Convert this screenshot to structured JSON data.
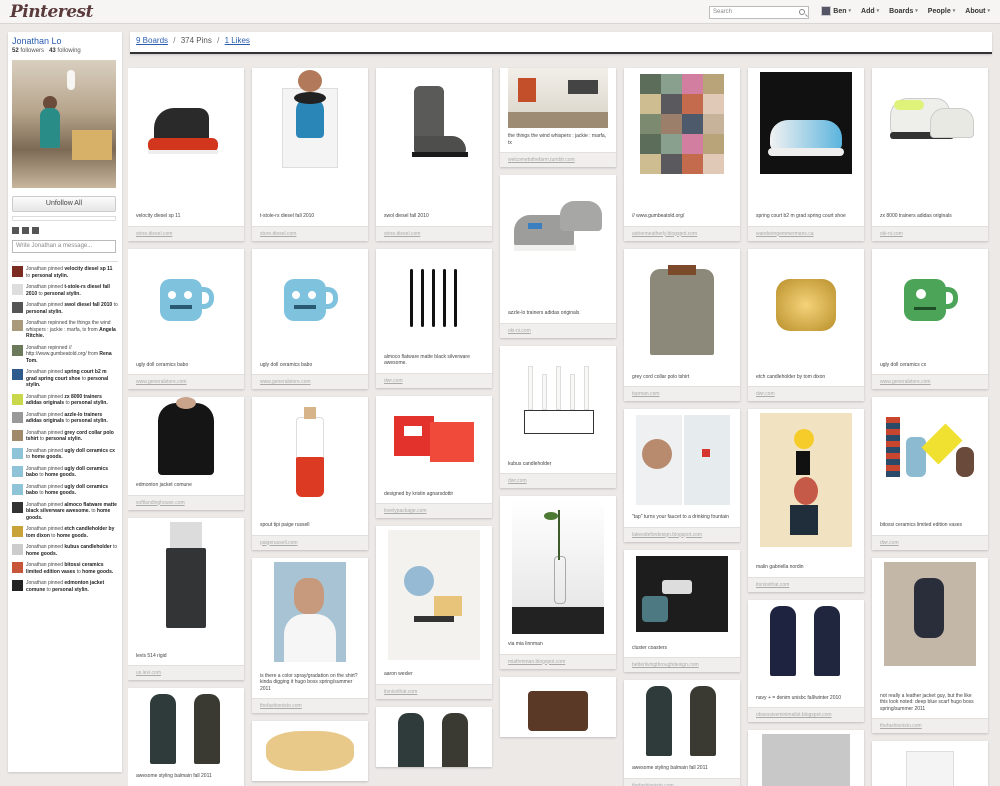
{
  "app": {
    "logo": "Pinterest"
  },
  "topbar": {
    "search_placeholder": "Search",
    "nav": [
      {
        "label": "Ben",
        "has_avatar": true
      },
      {
        "label": "Add"
      },
      {
        "label": "Boards"
      },
      {
        "label": "People"
      },
      {
        "label": "About"
      }
    ]
  },
  "profile": {
    "name": "Jonathan Lo",
    "followers_count": "52",
    "followers_label": "followers",
    "following_count": "43",
    "following_label": "following",
    "unfollow_label": "Unfollow All",
    "message_placeholder": "Write Jonathan a message..."
  },
  "activity": [
    {
      "pre": "Jonathan pinned ",
      "item": "velocity diesel sp 11",
      "mid": " to ",
      "board": "personal stylin."
    },
    {
      "pre": "Jonathan pinned ",
      "item": "t-stole-rs diesel fall 2010",
      "mid": " to ",
      "board": "personal stylin."
    },
    {
      "pre": "Jonathan pinned ",
      "item": "swol diesel fall 2010",
      "mid": " to ",
      "board": "personal stylin."
    },
    {
      "pre": "Jonathan repinned the things the wind whispers : jackie : marfa, tx",
      "item": "",
      "mid": " from ",
      "board": "Angela Ritchie."
    },
    {
      "pre": "Jonathan repinned // http://www.gumbeatold.org/",
      "item": "",
      "mid": " from ",
      "board": "Rena Tom."
    },
    {
      "pre": "Jonathan pinned ",
      "item": "spring court b2 m grad spring court shoe",
      "mid": " to ",
      "board": "personal stylin."
    },
    {
      "pre": "Jonathan pinned ",
      "item": "zx 8000 trainers adidas originals",
      "mid": " to ",
      "board": "personal stylin."
    },
    {
      "pre": "Jonathan pinned ",
      "item": "azzle-lo trainers adidas originals",
      "mid": " to ",
      "board": "personal stylin."
    },
    {
      "pre": "Jonathan pinned ",
      "item": "grey cord collar polo tshirt",
      "mid": " to ",
      "board": "personal stylin."
    },
    {
      "pre": "Jonathan pinned ",
      "item": "ugly doll ceramics cx",
      "mid": " to ",
      "board": "home goods."
    },
    {
      "pre": "Jonathan pinned ",
      "item": "ugly doll ceramics babo",
      "mid": " to ",
      "board": "home goods."
    },
    {
      "pre": "Jonathan pinned ",
      "item": "ugly doll ceramics babo",
      "mid": " to ",
      "board": "home goods."
    },
    {
      "pre": "Jonathan pinned ",
      "item": "almoco flatware matte black silverware awesome.",
      "mid": " to ",
      "board": "home goods."
    },
    {
      "pre": "Jonathan pinned ",
      "item": "etch candleholder by tom dixon",
      "mid": " to ",
      "board": "home goods."
    },
    {
      "pre": "Jonathan pinned ",
      "item": "kubus candleholder",
      "mid": " to ",
      "board": "home goods."
    },
    {
      "pre": "Jonathan pinned ",
      "item": "bitossi ceramics limited edition vases",
      "mid": " to ",
      "board": "home goods."
    },
    {
      "pre": "Jonathan pinned ",
      "item": "edmonton jacket comune",
      "mid": " to ",
      "board": "personal stylin."
    }
  ],
  "tabs": {
    "boards_label": "9 Boards",
    "pins_label": "374 Pins",
    "likes_label": "1 Likes"
  },
  "pins": [
    [
      {
        "cap": "velocity diesel sp 11",
        "src": "store.diesel.com",
        "h": 140,
        "art": "sneaker-red"
      },
      {
        "cap": "ugly doll ceramics babo",
        "src": "www.generalstore.com",
        "h": 108,
        "art": "mug-blue"
      },
      {
        "cap": "edmonton jacket comune",
        "src": "softlandinghouse.com",
        "h": 80,
        "art": "jacket"
      },
      {
        "cap": "levis 514 rigid",
        "src": "us.levi.com",
        "h": 130,
        "art": "jeans"
      },
      {
        "cap": "awesome styling balmain fall 2011",
        "src": "thefashionisto.com",
        "h": 80,
        "art": "men-pair"
      }
    ],
    [
      {
        "cap": "t-stole-rs diesel fall 2010",
        "src": "store.diesel.com",
        "h": 140,
        "art": "tshirt"
      },
      {
        "cap": "ugly doll ceramics babo",
        "src": "www.generalstore.com",
        "h": 108,
        "art": "mug-blue2"
      },
      {
        "cap": "spout tipi paige russell",
        "src": "paigerussell.com",
        "h": 120,
        "art": "bottle"
      },
      {
        "cap": "is there a color spray/gradation on the shirt? kinda digging it hugo boss spring/summer 2011",
        "src": "thefashionisto.com",
        "h": 110,
        "art": "portrait"
      },
      {
        "cap": "",
        "src": "",
        "h": 60,
        "art": "food"
      }
    ],
    [
      {
        "cap": "swol diesel fall 2010",
        "src": "store.diesel.com",
        "h": 140,
        "art": "boot"
      },
      {
        "cap": "almoco flatware matte black silverware awesome.",
        "src": "dwr.com",
        "h": 100,
        "art": "flatware"
      },
      {
        "cap": "designed by kristin agnarsdottir",
        "src": "lovelypackage.com",
        "h": 90,
        "art": "packaging"
      },
      {
        "cap": "aaron wexler",
        "src": "itsnicethat.com",
        "h": 140,
        "art": "abstract"
      },
      {
        "cap": "",
        "src": "",
        "h": 60,
        "art": "men-walk"
      }
    ],
    [
      {
        "cap": "the things the wind whispers : jackie : marfa, tx",
        "src": "welcometothefarm.tumblr.com",
        "h": 80,
        "art": "room"
      },
      {
        "cap": "azzle-lo trainers adidas originals",
        "src": "oki-ni.com",
        "h": 130,
        "art": "sneaker-grey"
      },
      {
        "cap": "kubus candleholder",
        "src": "dwr.com",
        "h": 110,
        "art": "candles"
      },
      {
        "cap": "via mia linnman",
        "src": "miafirmman.blogspot.com",
        "h": 140,
        "art": "vase-branch"
      },
      {
        "cap": "",
        "src": "",
        "h": 60,
        "art": "bag"
      }
    ],
    [
      {
        "cap": "// www.gumbeatold.org/",
        "src": "adrienneatherly.blogspot.com",
        "h": 140,
        "art": "quilt"
      },
      {
        "cap": "grey cord collar polo tshirt",
        "src": "topman.com",
        "h": 120,
        "art": "polo"
      },
      {
        "cap": "\"tap\" turns your faucet to a drinking fountain",
        "src": "lakesidefordesign.blogspot.com",
        "h": 100,
        "art": "faucet"
      },
      {
        "cap": "cluster coasters",
        "src": "betterlivingthroughdesign.com",
        "h": 90,
        "art": "coasters"
      },
      {
        "cap": "awesome styling balmain fall 2011",
        "src": "thefashionisto.com",
        "h": 80,
        "art": "men-walk2"
      }
    ],
    [
      {
        "cap": "spring court b2 m grad spring court shoe",
        "src": "wanderingemmermans.ca",
        "h": 140,
        "art": "sneaker-blue"
      },
      {
        "cap": "etch candleholder by tom dixon",
        "src": "dwr.com",
        "h": 120,
        "art": "etch"
      },
      {
        "cap": "malin gabriella nordin",
        "src": "itsnicethat.com",
        "h": 150,
        "art": "sculpture"
      },
      {
        "cap": "navy + = denim unisbc fall/winter 2010",
        "src": "obsessiveminimalist.blogspot.com",
        "h": 90,
        "art": "men-navy"
      },
      {
        "cap": "",
        "src": "",
        "h": 60,
        "art": "grey"
      }
    ],
    [
      {
        "cap": "zx 8000 trainers adidas originals",
        "src": "oki-ni.com",
        "h": 140,
        "art": "sneaker-lime"
      },
      {
        "cap": "ugly doll ceramics cx",
        "src": "www.generalstore.com",
        "h": 108,
        "art": "mug-green"
      },
      {
        "cap": "bitossi ceramics limited edition vases",
        "src": "dwr.com",
        "h": 120,
        "art": "vases"
      },
      {
        "cap": "not really a leather jacket guy, but the like this look noted: deep blue scarf hugo boss spring/summer 2011",
        "src": "thefashionisto.com",
        "h": 130,
        "art": "rock-man"
      },
      {
        "cap": "",
        "src": "",
        "h": 60,
        "art": "tee-small"
      }
    ]
  ]
}
